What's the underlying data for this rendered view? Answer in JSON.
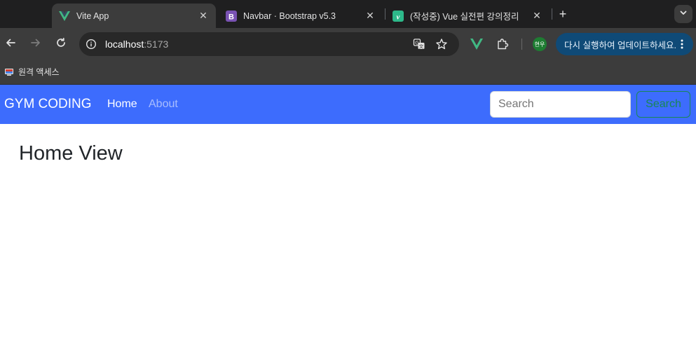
{
  "browser": {
    "tabs": [
      {
        "title": "Vite App",
        "icon": "vue-icon",
        "active": true
      },
      {
        "title": "Navbar · Bootstrap v5.3",
        "icon": "bootstrap-icon",
        "active": false
      },
      {
        "title": "(작성중) Vue 실전편 강의정리",
        "icon": "vue-notes-icon",
        "active": false
      }
    ],
    "url": {
      "host": "localhost",
      "port": ":5173"
    },
    "profile_label": "현우",
    "update_label": "다시 실행하여 업데이트하세요.",
    "bookmarks": [
      {
        "label": "원격 액세스",
        "icon": "remote-access-icon"
      }
    ],
    "colors": {
      "frame": "#1f1f20",
      "toolbar": "#3c3c3c",
      "update_pill": "#0f4a77"
    }
  },
  "page": {
    "navbar": {
      "brand": "GYM CODING",
      "links": [
        {
          "label": "Home",
          "active": true
        },
        {
          "label": "About",
          "active": false
        }
      ],
      "search_placeholder": "Search",
      "search_button": "Search",
      "colors": {
        "background": "#3d6cfd",
        "button": "#198754"
      }
    },
    "heading": "Home View"
  }
}
